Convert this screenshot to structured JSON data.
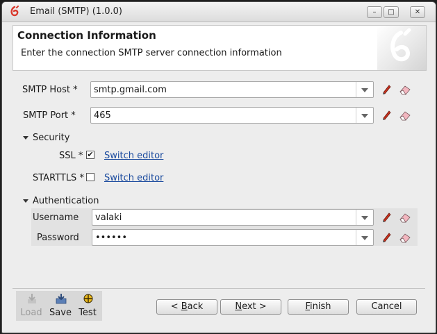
{
  "window": {
    "title": "Email (SMTP) (1.0.0)"
  },
  "header": {
    "title": "Connection Information",
    "description": "Enter the connection SMTP server connection information"
  },
  "smtp_host": {
    "label": "SMTP Host *",
    "value": "smtp.gmail.com"
  },
  "smtp_port": {
    "label": "SMTP Port *",
    "value": "465"
  },
  "security": {
    "title": "Security",
    "ssl": {
      "label": "SSL *",
      "checked": true,
      "check_mark": "✔",
      "link": "Switch editor"
    },
    "starttls": {
      "label": "STARTTLS *",
      "checked": false,
      "link": "Switch editor"
    }
  },
  "authentication": {
    "title": "Authentication",
    "username": {
      "label": "Username",
      "value": "valaki"
    },
    "password": {
      "label": "Password",
      "value": "••••••"
    }
  },
  "toolbar": {
    "load": "Load",
    "save": "Save",
    "test": "Test"
  },
  "buttons": {
    "back": {
      "prefix": "< ",
      "mnemonic": "B",
      "rest": "ack"
    },
    "next": {
      "mnemonic": "N",
      "rest": "ext >"
    },
    "finish": {
      "mnemonic": "F",
      "rest": "inish"
    },
    "cancel": "Cancel"
  },
  "icons": {
    "app": "app-logo-icon",
    "edit": "pencil-icon",
    "clear": "eraser-icon",
    "load": "load-icon",
    "save": "save-icon",
    "test": "test-icon"
  },
  "colors": {
    "link": "#1a4a9e",
    "app_logo": "#d9372b",
    "pencil": "#c8321e"
  }
}
